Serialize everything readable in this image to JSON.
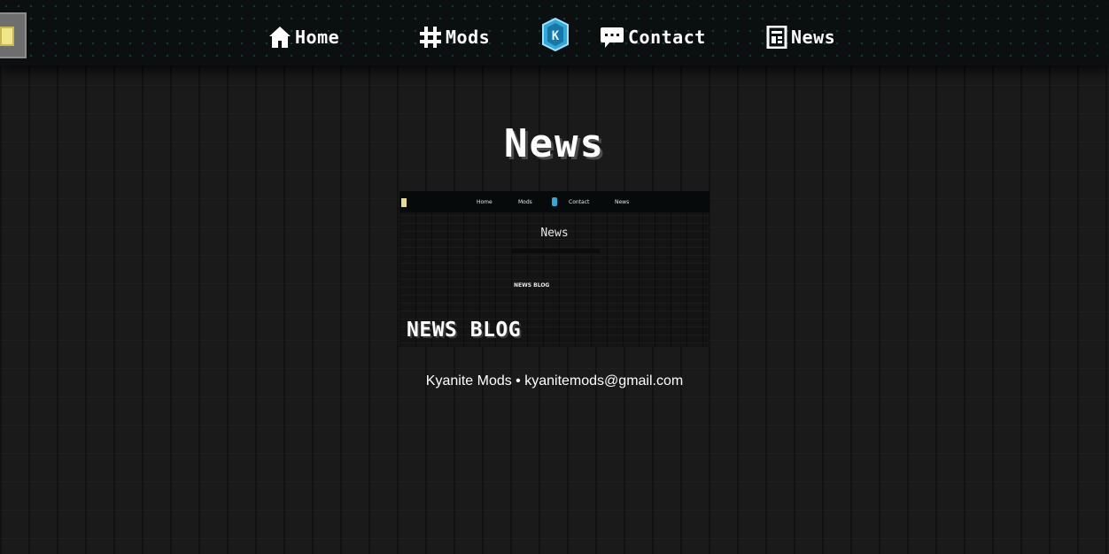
{
  "nav": {
    "items": [
      {
        "label": "Home",
        "icon": "house-icon"
      },
      {
        "label": "Mods",
        "icon": "hashtag-icon"
      },
      {
        "label": "Contact",
        "icon": "chat-bubble-icon"
      },
      {
        "label": "News",
        "icon": "newspaper-icon"
      }
    ],
    "logo_letter": "K",
    "logo_icon": "kyanite-gem-icon",
    "accent_color": "#2fa9d8"
  },
  "page": {
    "title": "News"
  },
  "thumbnail": {
    "nav_items": [
      "Home",
      "Mods",
      "Contact",
      "News"
    ],
    "title": "News",
    "heading": "NEWS BLOG"
  },
  "blog": {
    "heading": "NEWS BLOG"
  },
  "footer": {
    "text": "Kyanite Mods • kyanitemods@gmail.com"
  }
}
